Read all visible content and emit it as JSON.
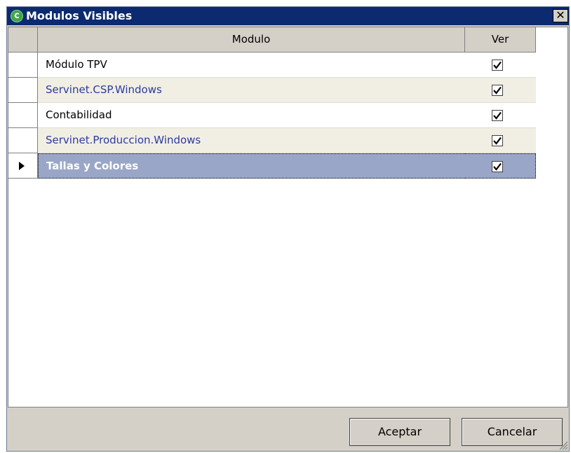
{
  "window": {
    "title": "Modulos Visibles",
    "close_glyph": "✕",
    "icon_letter": "c"
  },
  "grid": {
    "columns": [
      "Modulo",
      "Ver"
    ],
    "rows": [
      {
        "modulo": "Módulo TPV",
        "ver": true,
        "selected": false
      },
      {
        "modulo": "Servinet.CSP.Windows",
        "ver": true,
        "selected": false
      },
      {
        "modulo": "Contabilidad",
        "ver": true,
        "selected": false
      },
      {
        "modulo": "Servinet.Produccion.Windows",
        "ver": true,
        "selected": false
      },
      {
        "modulo": "Tallas y Colores",
        "ver": true,
        "selected": true
      }
    ]
  },
  "buttons": {
    "ok": "Aceptar",
    "cancel": "Cancelar"
  },
  "colors": {
    "titlebar": "#0b2a6f",
    "selected_row": "#9aa6c7",
    "alt_row": "#f1eee4",
    "link_text": "#2b3c9c"
  }
}
